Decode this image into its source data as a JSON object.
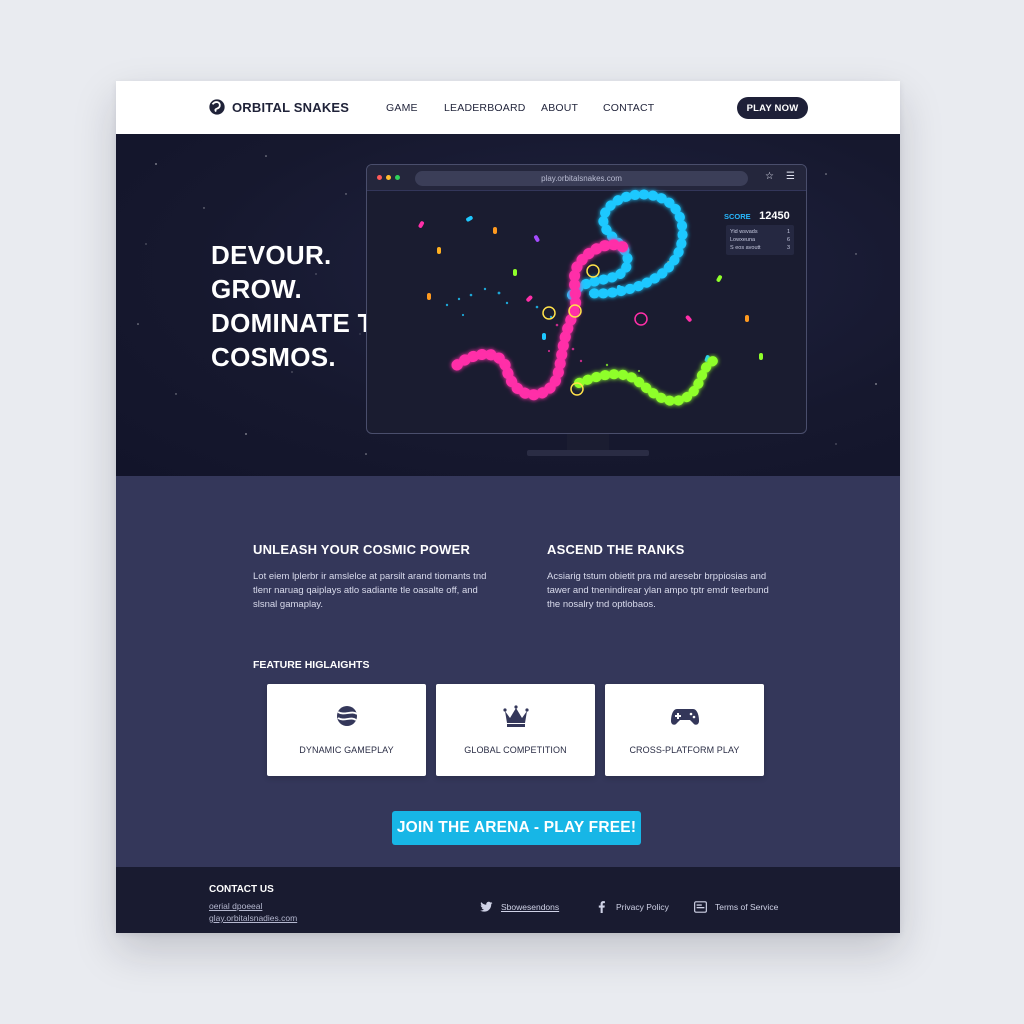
{
  "nav": {
    "brand": "ORBITAL SNAKES",
    "links": [
      "GAME",
      "LEADERBOARD",
      "ABOUT",
      "CONTACT"
    ],
    "cta": "PLAY NOW"
  },
  "hero": {
    "headline": [
      "DEVOUR.",
      "GROW.",
      "DOMINATE THE",
      "COSMOS."
    ],
    "browser_url": "play.orbitalsnakes.com",
    "score_label": "SCORE",
    "score_value": "12450",
    "leaderboard_rows": [
      {
        "name": "Yid wsvads",
        "rank": "1"
      },
      {
        "name": "Lowxeuna",
        "rank": "6"
      },
      {
        "name": "S eos avoutt",
        "rank": "3"
      }
    ]
  },
  "sections": [
    {
      "title": "UNLEASH YOUR COSMIC POWER",
      "text": "Lot eiem lplerbr ir amslelce at parsilt arand tiomants tnd tlenr naruag qaiplays atlo sadiante tle oasalte off, and slsnal gamaplay."
    },
    {
      "title": "ASCEND THE RANKS",
      "text": "Acsiarig tstum obietit pra md aresebr brppiosias and tawer and tnenindirear ylan ampo tptr emdr teerbund the nosalry tnd optlobaos."
    }
  ],
  "features": {
    "heading": "FEATURE HIGLAIGHTS",
    "cards": [
      {
        "label": "DYNAMIC GAMEPLAY",
        "icon": "planet-icon"
      },
      {
        "label": "GLOBAL COMPETITION",
        "icon": "crown-icon"
      },
      {
        "label": "CROSS-PLATFORM PLAY",
        "icon": "gamepad-icon"
      }
    ]
  },
  "cta": {
    "label": "JOIN THE ARENA - PLAY FREE!"
  },
  "footer": {
    "contact_title": "CONTACT US",
    "contact_lines": [
      "oerial dpoeeal",
      "glay.orbitalsnadies.com"
    ],
    "links": [
      {
        "label": "Sbowesendons",
        "icon": "twitter-icon"
      },
      {
        "label": "Privacy Policy",
        "icon": "facebook-icon"
      },
      {
        "label": "Terms of Service",
        "icon": "document-icon"
      }
    ]
  },
  "colors": {
    "accent_cyan": "#17b6e6",
    "snake_blue": "#1ec8ff",
    "snake_pink": "#ff2fa8",
    "snake_green": "#8fff2a",
    "navy": "#1e2038"
  }
}
